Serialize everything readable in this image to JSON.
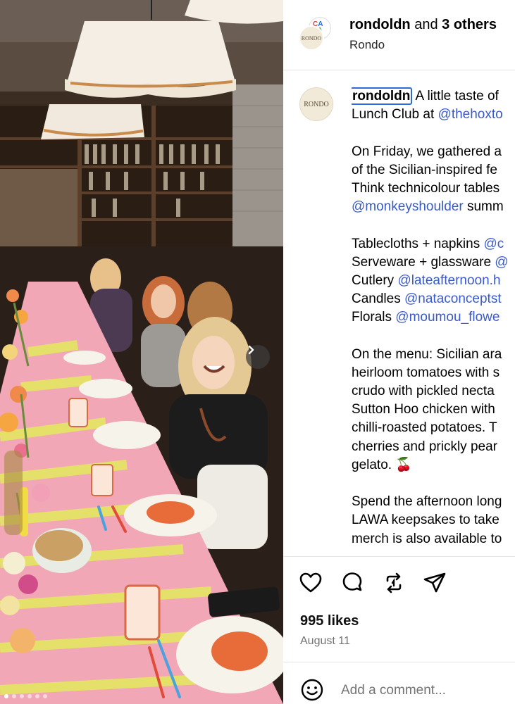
{
  "post": {
    "header": {
      "username": "rondoldn",
      "and_text": "and",
      "others": "3 others",
      "subtitle": "Rondo",
      "collab_avatar_text": "CASA LAVA",
      "avatar_text": "RONDO"
    },
    "caption": {
      "avatar_text": "RONDO",
      "username": "rondoldn",
      "lines": [
        {
          "parts": [
            {
              "t": " A little taste of ",
              "m": false
            }
          ]
        },
        {
          "parts": [
            {
              "t": "Lunch Club at ",
              "m": false
            },
            {
              "t": "@thehoxto",
              "m": true
            }
          ]
        },
        {
          "gap": true
        },
        {
          "parts": [
            {
              "t": "On Friday, we gathered a",
              "m": false
            }
          ]
        },
        {
          "parts": [
            {
              "t": "of the Sicilian-inspired fe",
              "m": false
            }
          ]
        },
        {
          "parts": [
            {
              "t": "Think technicolour tables",
              "m": false
            }
          ]
        },
        {
          "parts": [
            {
              "t": "@monkeyshoulder",
              "m": true
            },
            {
              "t": " summ",
              "m": false
            }
          ]
        },
        {
          "gap": true
        },
        {
          "parts": [
            {
              "t": "Tablecloths + napkins ",
              "m": false
            },
            {
              "t": "@c",
              "m": true
            }
          ]
        },
        {
          "parts": [
            {
              "t": "Serveware + glassware ",
              "m": false
            },
            {
              "t": "@",
              "m": true
            }
          ]
        },
        {
          "parts": [
            {
              "t": "Cutlery ",
              "m": false
            },
            {
              "t": "@lateafternoon.h",
              "m": true
            }
          ]
        },
        {
          "parts": [
            {
              "t": "Candles ",
              "m": false
            },
            {
              "t": "@nataconceptst",
              "m": true
            }
          ]
        },
        {
          "parts": [
            {
              "t": "Florals ",
              "m": false
            },
            {
              "t": "@moumou_flowe",
              "m": true
            }
          ]
        },
        {
          "gap": true
        },
        {
          "parts": [
            {
              "t": "On the menu: Sicilian ara",
              "m": false
            }
          ]
        },
        {
          "parts": [
            {
              "t": "heirloom tomatoes with s",
              "m": false
            }
          ]
        },
        {
          "parts": [
            {
              "t": "crudo with pickled necta",
              "m": false
            }
          ]
        },
        {
          "parts": [
            {
              "t": "Sutton Hoo chicken with",
              "m": false
            }
          ]
        },
        {
          "parts": [
            {
              "t": "chilli-roasted potatoes. T",
              "m": false
            }
          ]
        },
        {
          "parts": [
            {
              "t": "cherries and prickly pear",
              "m": false
            }
          ]
        },
        {
          "parts": [
            {
              "t": "gelato. 🍒",
              "m": false
            }
          ]
        },
        {
          "gap": true
        },
        {
          "parts": [
            {
              "t": "Spend the afternoon long",
              "m": false
            }
          ]
        },
        {
          "parts": [
            {
              "t": "LAWA keepsakes to take",
              "m": false
            }
          ]
        },
        {
          "parts": [
            {
              "t": "merch is also available to",
              "m": false
            }
          ]
        }
      ]
    },
    "likes": "995 likes",
    "date": "August 11",
    "comment_placeholder": "Add a comment...",
    "carousel": {
      "count": 6,
      "active": 1
    }
  },
  "icons": {
    "like": "heart-icon",
    "comment": "comment-bubble-icon",
    "repost": "repost-icon",
    "share": "send-icon",
    "next": "chevron-right-icon",
    "emoji": "smiley-icon"
  },
  "colors": {
    "mention": "#3a5bc7",
    "focus_ring": "#2f6bd8",
    "muted": "#737373"
  }
}
